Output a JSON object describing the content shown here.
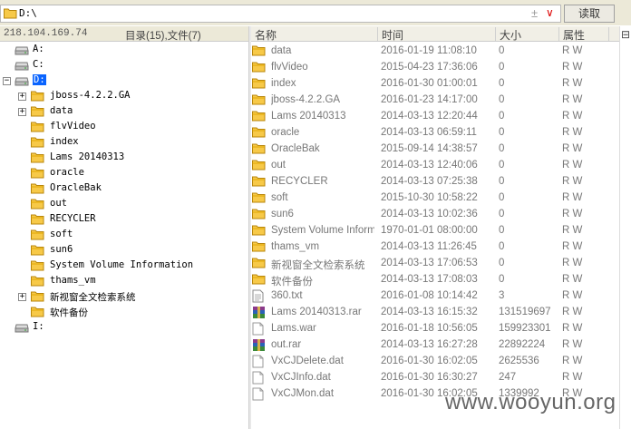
{
  "path": {
    "value": "D:\\",
    "read_label": "读取"
  },
  "left_header": {
    "ip": "218.104.169.74",
    "counts": "目录(15),文件(7)"
  },
  "tree": [
    {
      "label": "A:",
      "icon": "drive-icon",
      "expander": ""
    },
    {
      "label": "C:",
      "icon": "drive-icon",
      "expander": ""
    },
    {
      "label": "D:",
      "icon": "drive-icon",
      "expander": "−",
      "selected": true
    },
    {
      "label": "jboss-4.2.2.GA",
      "icon": "folder-icon",
      "expander": "+"
    },
    {
      "label": "data",
      "icon": "folder-icon",
      "expander": "+"
    },
    {
      "label": "flvVideo",
      "icon": "folder-icon",
      "expander": ""
    },
    {
      "label": "index",
      "icon": "folder-icon",
      "expander": ""
    },
    {
      "label": "Lams 20140313",
      "icon": "folder-icon",
      "expander": ""
    },
    {
      "label": "oracle",
      "icon": "folder-icon",
      "expander": ""
    },
    {
      "label": "OracleBak",
      "icon": "folder-icon",
      "expander": ""
    },
    {
      "label": "out",
      "icon": "folder-icon",
      "expander": ""
    },
    {
      "label": "RECYCLER",
      "icon": "folder-icon",
      "expander": ""
    },
    {
      "label": "soft",
      "icon": "folder-icon",
      "expander": ""
    },
    {
      "label": "sun6",
      "icon": "folder-icon",
      "expander": ""
    },
    {
      "label": "System Volume Information",
      "icon": "folder-icon",
      "expander": ""
    },
    {
      "label": "thams_vm",
      "icon": "folder-icon",
      "expander": ""
    },
    {
      "label": "新视窗全文检索系统",
      "icon": "folder-icon",
      "expander": "+"
    },
    {
      "label": "软件备份",
      "icon": "folder-icon",
      "expander": ""
    },
    {
      "label": "I:",
      "icon": "drive-icon",
      "expander": ""
    }
  ],
  "columns": {
    "name": "名称",
    "time": "时间",
    "size": "大小",
    "attr": "属性"
  },
  "files": [
    {
      "name": "data",
      "time": "2016-01-19 11:08:10",
      "size": "0",
      "attr": "R W",
      "icon": "folder-icon"
    },
    {
      "name": "flvVideo",
      "time": "2015-04-23 17:36:06",
      "size": "0",
      "attr": "R W",
      "icon": "folder-icon"
    },
    {
      "name": "index",
      "time": "2016-01-30 01:00:01",
      "size": "0",
      "attr": "R W",
      "icon": "folder-icon"
    },
    {
      "name": "jboss-4.2.2.GA",
      "time": "2016-01-23 14:17:00",
      "size": "0",
      "attr": "R W",
      "icon": "folder-icon"
    },
    {
      "name": "Lams 20140313",
      "time": "2014-03-13 12:20:44",
      "size": "0",
      "attr": "R W",
      "icon": "folder-icon"
    },
    {
      "name": "oracle",
      "time": "2014-03-13 06:59:11",
      "size": "0",
      "attr": "R W",
      "icon": "folder-icon"
    },
    {
      "name": "OracleBak",
      "time": "2015-09-14 14:38:57",
      "size": "0",
      "attr": "R W",
      "icon": "folder-icon"
    },
    {
      "name": "out",
      "time": "2014-03-13 12:40:06",
      "size": "0",
      "attr": "R W",
      "icon": "folder-icon"
    },
    {
      "name": "RECYCLER",
      "time": "2014-03-13 07:25:38",
      "size": "0",
      "attr": "R W",
      "icon": "folder-icon"
    },
    {
      "name": "soft",
      "time": "2015-10-30 10:58:22",
      "size": "0",
      "attr": "R W",
      "icon": "folder-icon"
    },
    {
      "name": "sun6",
      "time": "2014-03-13 10:02:36",
      "size": "0",
      "attr": "R W",
      "icon": "folder-icon"
    },
    {
      "name": "System Volume Inform...",
      "time": "1970-01-01 08:00:00",
      "size": "0",
      "attr": "R W",
      "icon": "folder-icon"
    },
    {
      "name": "thams_vm",
      "time": "2014-03-13 11:26:45",
      "size": "0",
      "attr": "R W",
      "icon": "folder-icon"
    },
    {
      "name": "新视窗全文检索系统",
      "time": "2014-03-13 17:06:53",
      "size": "0",
      "attr": "R W",
      "icon": "folder-icon"
    },
    {
      "name": "软件备份",
      "time": "2014-03-13 17:08:03",
      "size": "0",
      "attr": "R W",
      "icon": "folder-icon"
    },
    {
      "name": "360.txt",
      "time": "2016-01-08 10:14:42",
      "size": "3",
      "attr": "R W",
      "icon": "text-file-icon"
    },
    {
      "name": "Lams 20140313.rar",
      "time": "2014-03-13 16:15:32",
      "size": "131519697",
      "attr": "R W",
      "icon": "rar-archive-icon"
    },
    {
      "name": "Lams.war",
      "time": "2016-01-18 10:56:05",
      "size": "159923301",
      "attr": "R W",
      "icon": "file-icon"
    },
    {
      "name": "out.rar",
      "time": "2014-03-13 16:27:28",
      "size": "22892224",
      "attr": "R W",
      "icon": "rar-archive-icon"
    },
    {
      "name": "VxCJDelete.dat",
      "time": "2016-01-30 16:02:05",
      "size": "2625536",
      "attr": "R W",
      "icon": "file-icon"
    },
    {
      "name": "VxCJInfo.dat",
      "time": "2016-01-30 16:30:27",
      "size": "247",
      "attr": "R W",
      "icon": "file-icon"
    },
    {
      "name": "VxCJMon.dat",
      "time": "2016-01-30 16:02:05",
      "size": "1339992",
      "attr": "R W",
      "icon": "file-icon"
    }
  ],
  "watermark": "www.wooyun.org",
  "colors": {
    "folder": "#f7c948",
    "selection": "#0a64ff"
  }
}
